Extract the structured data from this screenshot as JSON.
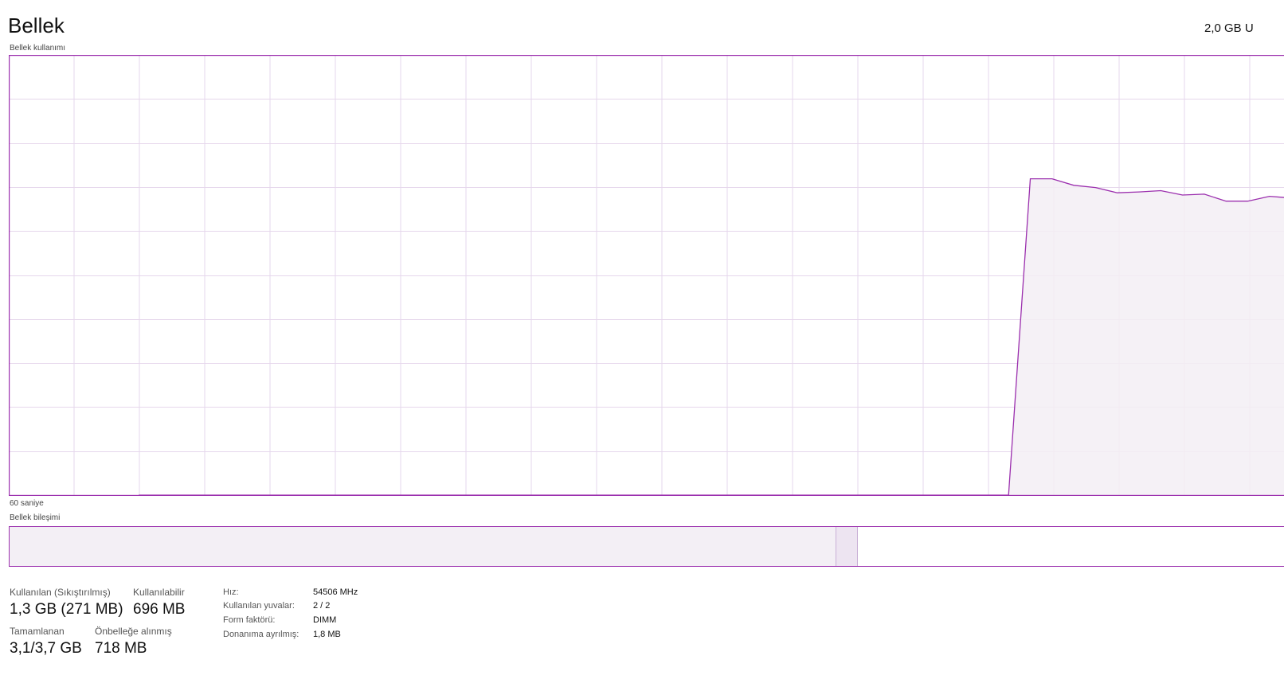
{
  "header": {
    "title": "Bellek",
    "total": "2,0 GB U"
  },
  "graph": {
    "label": "Bellek kullanımı",
    "time_label": "60 saniye",
    "accent_color": "#9b2fae",
    "grid_color": "#e6d7ec",
    "fill_color": "#f3eff5"
  },
  "chart_data": {
    "type": "area",
    "xlabel": "60 saniye",
    "ylim": [
      0,
      100
    ],
    "x_unit": "seconds ago",
    "series": [
      {
        "values_pct": [
          0,
          0,
          0,
          0,
          0,
          0,
          0,
          0,
          0,
          0,
          0,
          0,
          0,
          0,
          0,
          0,
          0,
          0,
          0,
          0,
          0,
          0,
          0,
          0,
          0,
          0,
          0,
          0,
          0,
          0,
          0,
          0,
          0,
          0,
          0,
          0,
          0,
          0,
          0,
          0,
          0,
          72,
          72,
          70.5,
          70,
          68.8,
          69,
          69.3,
          68.3,
          68.5,
          66.9,
          66.9,
          68,
          67.6,
          66.9,
          66.7,
          66.9
        ]
      }
    ]
  },
  "composition": {
    "label": "Bellek bileşimi",
    "in_use_fraction": 0.648,
    "modified_fraction": 0.016
  },
  "stats": {
    "in_use_label": "Kullanılan (Sıkıştırılmış)",
    "in_use_value": "1,3 GB (271 MB)",
    "available_label": "Kullanılabilir",
    "available_value": "696 MB",
    "committed_label": "Tamamlanan",
    "committed_value": "3,1/3,7 GB",
    "cached_label": "Önbelleğe alınmış",
    "cached_value": "718 MB"
  },
  "details": {
    "speed_label": "Hız:",
    "speed_value": "54506 MHz",
    "slots_label": "Kullanılan yuvalar:",
    "slots_value": "2 / 2",
    "form_label": "Form faktörü:",
    "form_value": "DIMM",
    "reserved_label": "Donanıma ayrılmış:",
    "reserved_value": "1,8 MB"
  }
}
